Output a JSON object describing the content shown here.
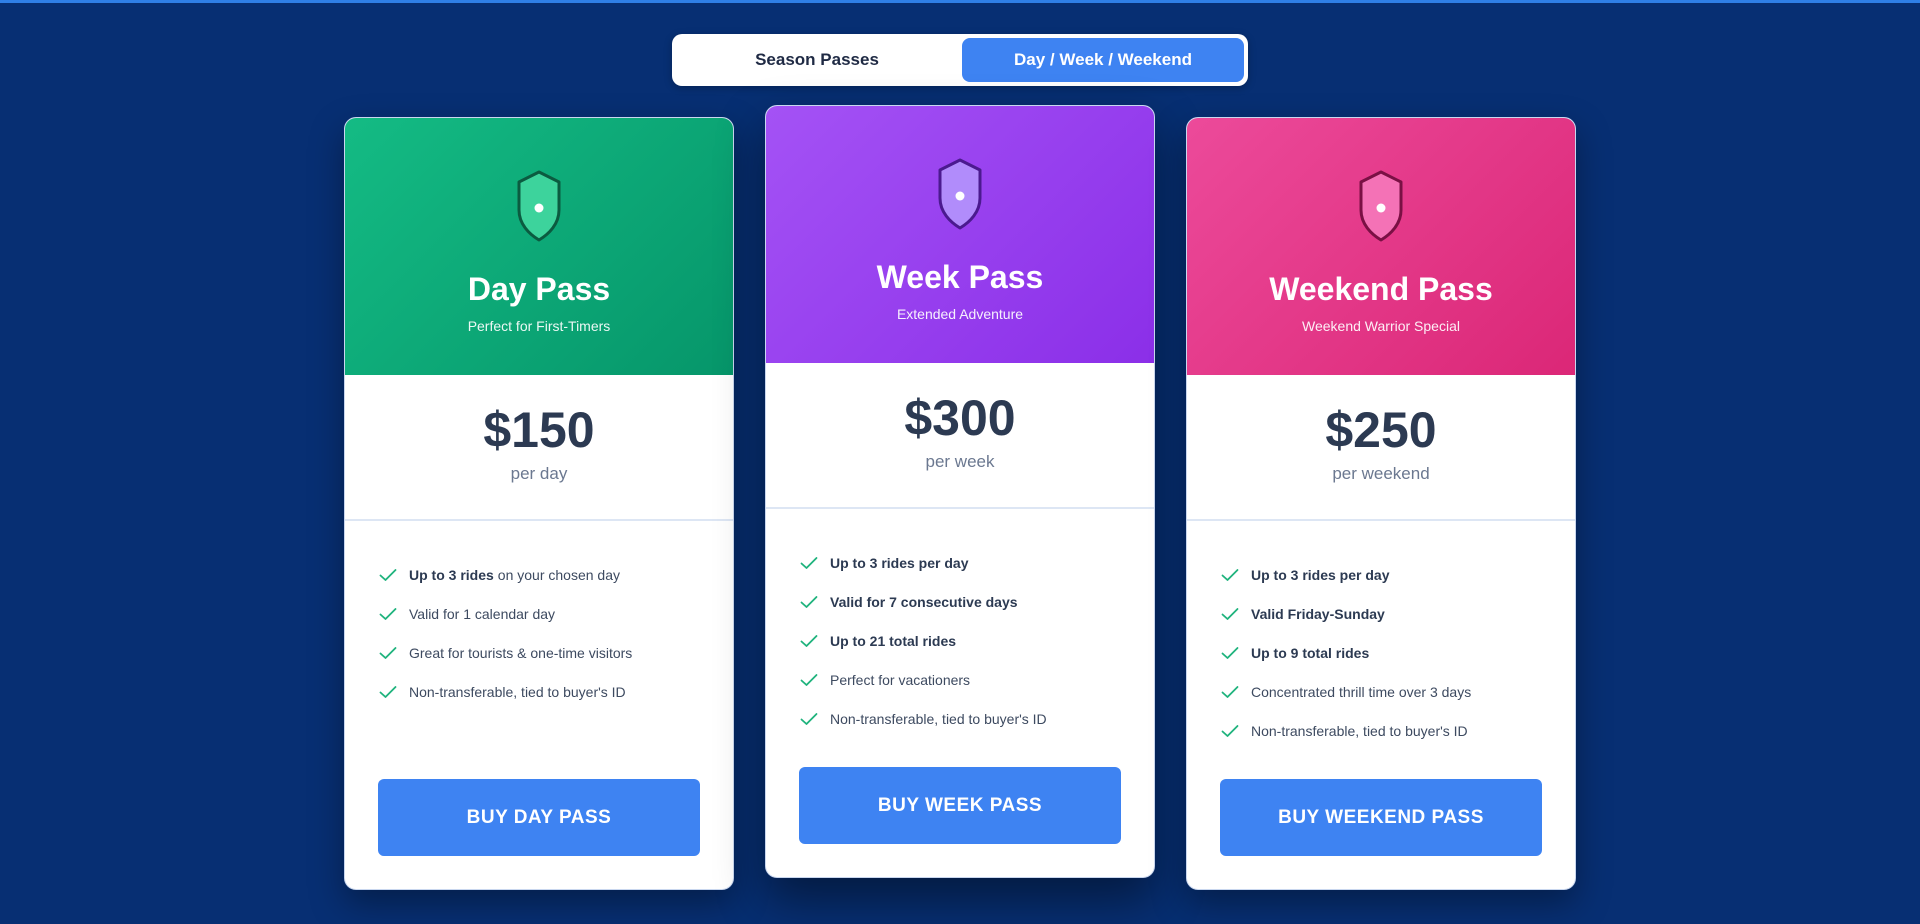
{
  "toggle": {
    "season_label": "Season Passes",
    "day_week_label": "Day / Week / Weekend"
  },
  "colors": {
    "background": "#072f73",
    "accent_blue": "#3e83f2",
    "day_green": "#0ea572",
    "week_purple": "#9b44f0",
    "weekend_pink": "#e43b8a"
  },
  "cards": [
    {
      "icon": "shield-icon",
      "title": "Day Pass",
      "subtitle": "Perfect for First-Timers",
      "price": "$150",
      "period": "per day",
      "features": [
        {
          "bold": "Up to 3 rides",
          "text": "on your chosen day"
        },
        {
          "bold": "",
          "text": "Valid for 1 calendar day"
        },
        {
          "bold": "",
          "text": "Great for tourists & one-time visitors"
        },
        {
          "bold": "",
          "text": "Non-transferable, tied to buyer's ID"
        }
      ],
      "button": "BUY DAY PASS"
    },
    {
      "icon": "shield-icon",
      "title": "Week Pass",
      "subtitle": "Extended Adventure",
      "price": "$300",
      "period": "per week",
      "features": [
        {
          "bold": "Up to 3 rides per day",
          "text": ""
        },
        {
          "bold": "Valid for 7 consecutive days",
          "text": ""
        },
        {
          "bold": "Up to 21 total rides",
          "text": ""
        },
        {
          "bold": "",
          "text": "Perfect for vacationers"
        },
        {
          "bold": "",
          "text": "Non-transferable, tied to buyer's ID"
        }
      ],
      "button": "BUY WEEK PASS"
    },
    {
      "icon": "shield-icon",
      "title": "Weekend Pass",
      "subtitle": "Weekend Warrior Special",
      "price": "$250",
      "period": "per weekend",
      "features": [
        {
          "bold": "Up to 3 rides per day",
          "text": ""
        },
        {
          "bold": "Valid Friday-Sunday",
          "text": ""
        },
        {
          "bold": "Up to 9 total rides",
          "text": ""
        },
        {
          "bold": "",
          "text": "Concentrated thrill time over 3 days"
        },
        {
          "bold": "",
          "text": "Non-transferable, tied to buyer's ID"
        }
      ],
      "button": "BUY WEEKEND PASS"
    }
  ]
}
